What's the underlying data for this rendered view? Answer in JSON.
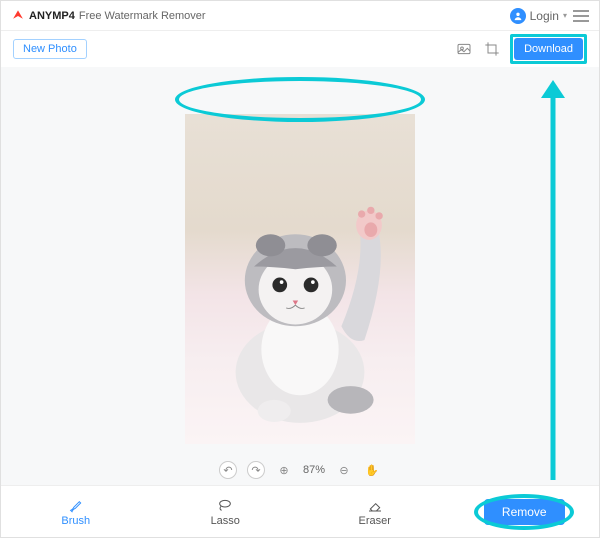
{
  "header": {
    "brand": "ANYMP4",
    "app_title": "Free Watermark Remover",
    "login_label": "Login"
  },
  "toolbar": {
    "new_photo_label": "New Photo",
    "download_label": "Download"
  },
  "canvas": {
    "zoom_percent": "87%"
  },
  "bottom": {
    "brush_label": "Brush",
    "lasso_label": "Lasso",
    "eraser_label": "Eraser",
    "remove_label": "Remove"
  },
  "annotations": {
    "highlight_color": "#0bcad6"
  }
}
